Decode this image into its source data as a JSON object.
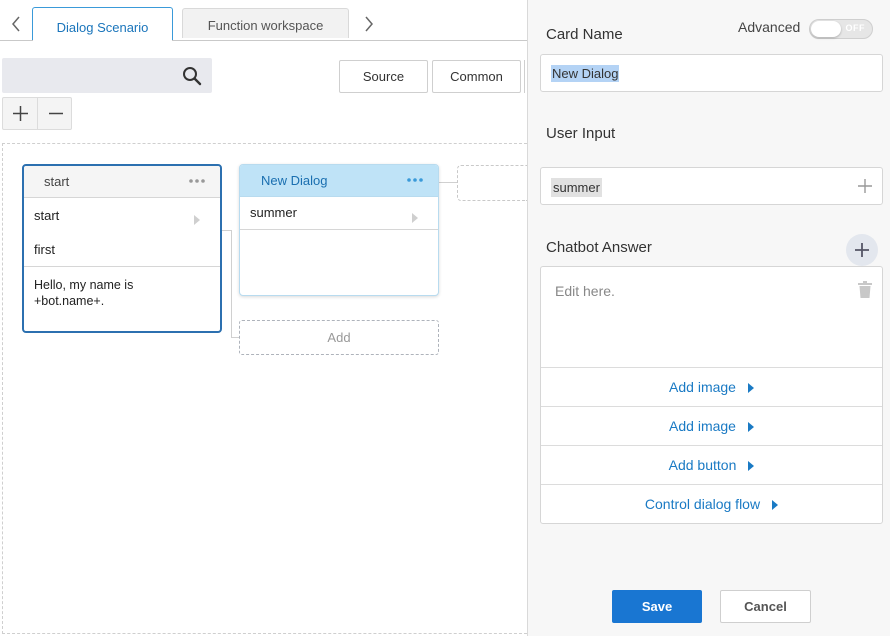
{
  "tabs": [
    {
      "label": "Dialog Scenario",
      "active": true
    },
    {
      "label": "Function workspace",
      "active": false
    }
  ],
  "search": {
    "placeholder": "",
    "value": ""
  },
  "toolbar": {
    "source_label": "Source",
    "common_label": "Common"
  },
  "zoom": {
    "plus": "+",
    "minus": "−"
  },
  "cards": {
    "start": {
      "title": "start",
      "rows": [
        "start",
        "first"
      ],
      "answer": "Hello, my name is +bot.name+."
    },
    "new_dialog": {
      "title": "New Dialog",
      "rows": [
        "summer"
      ]
    },
    "add_label": "Add"
  },
  "panel": {
    "card_name_label": "Card Name",
    "advanced_label": "Advanced",
    "toggle_text": "OFF",
    "card_name_value": "New Dialog",
    "user_input_label": "User Input",
    "user_input_value": "summer",
    "chatbot_answer_label": "Chatbot Answer",
    "answer_placeholder": "Edit here.",
    "actions": [
      "Add image",
      "Add image",
      "Add button",
      "Control dialog flow"
    ],
    "save_label": "Save",
    "cancel_label": "Cancel"
  },
  "colors": {
    "accent": "#1976d2",
    "link": "#1a7ac4",
    "selected_card_header": "#bfe3f7",
    "start_card_border": "#2c70b0"
  }
}
